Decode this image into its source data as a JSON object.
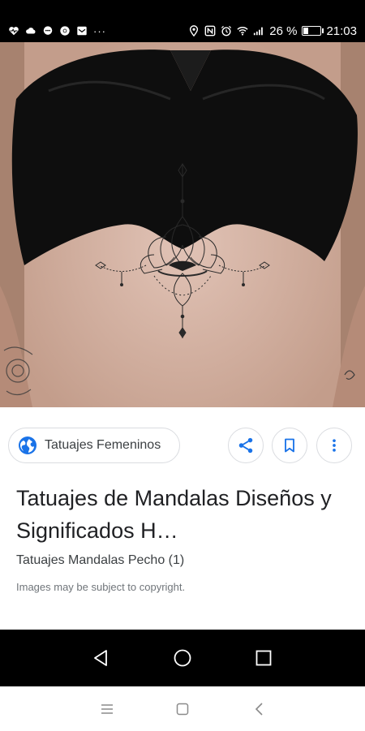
{
  "status_bar": {
    "time": "21:03",
    "battery_text": "26 %",
    "battery_level": 0.26,
    "left_icons": [
      "heart-rate-icon",
      "cloud-icon",
      "chat-icon",
      "chrome-icon",
      "mail-icon"
    ],
    "overflow": "···",
    "right_icons": [
      "location-icon",
      "nfc-icon",
      "alarm-icon",
      "wifi-icon",
      "signal-icon"
    ]
  },
  "image": {
    "alt": "Mandala underboob tattoo"
  },
  "card": {
    "source_label": "Tatuajes Femeninos",
    "title": "Tatuajes de Mandalas Diseños y Significados H…",
    "subtitle": "Tatuajes Mandalas Pecho (1)",
    "copyright": "Images may be subject to copyright.",
    "accent_color": "#1a73e8"
  },
  "nav": {
    "system": [
      "back-icon",
      "home-icon",
      "recents-icon"
    ],
    "browser": [
      "menu-icon",
      "tabs-icon",
      "back-chevron-icon"
    ]
  }
}
